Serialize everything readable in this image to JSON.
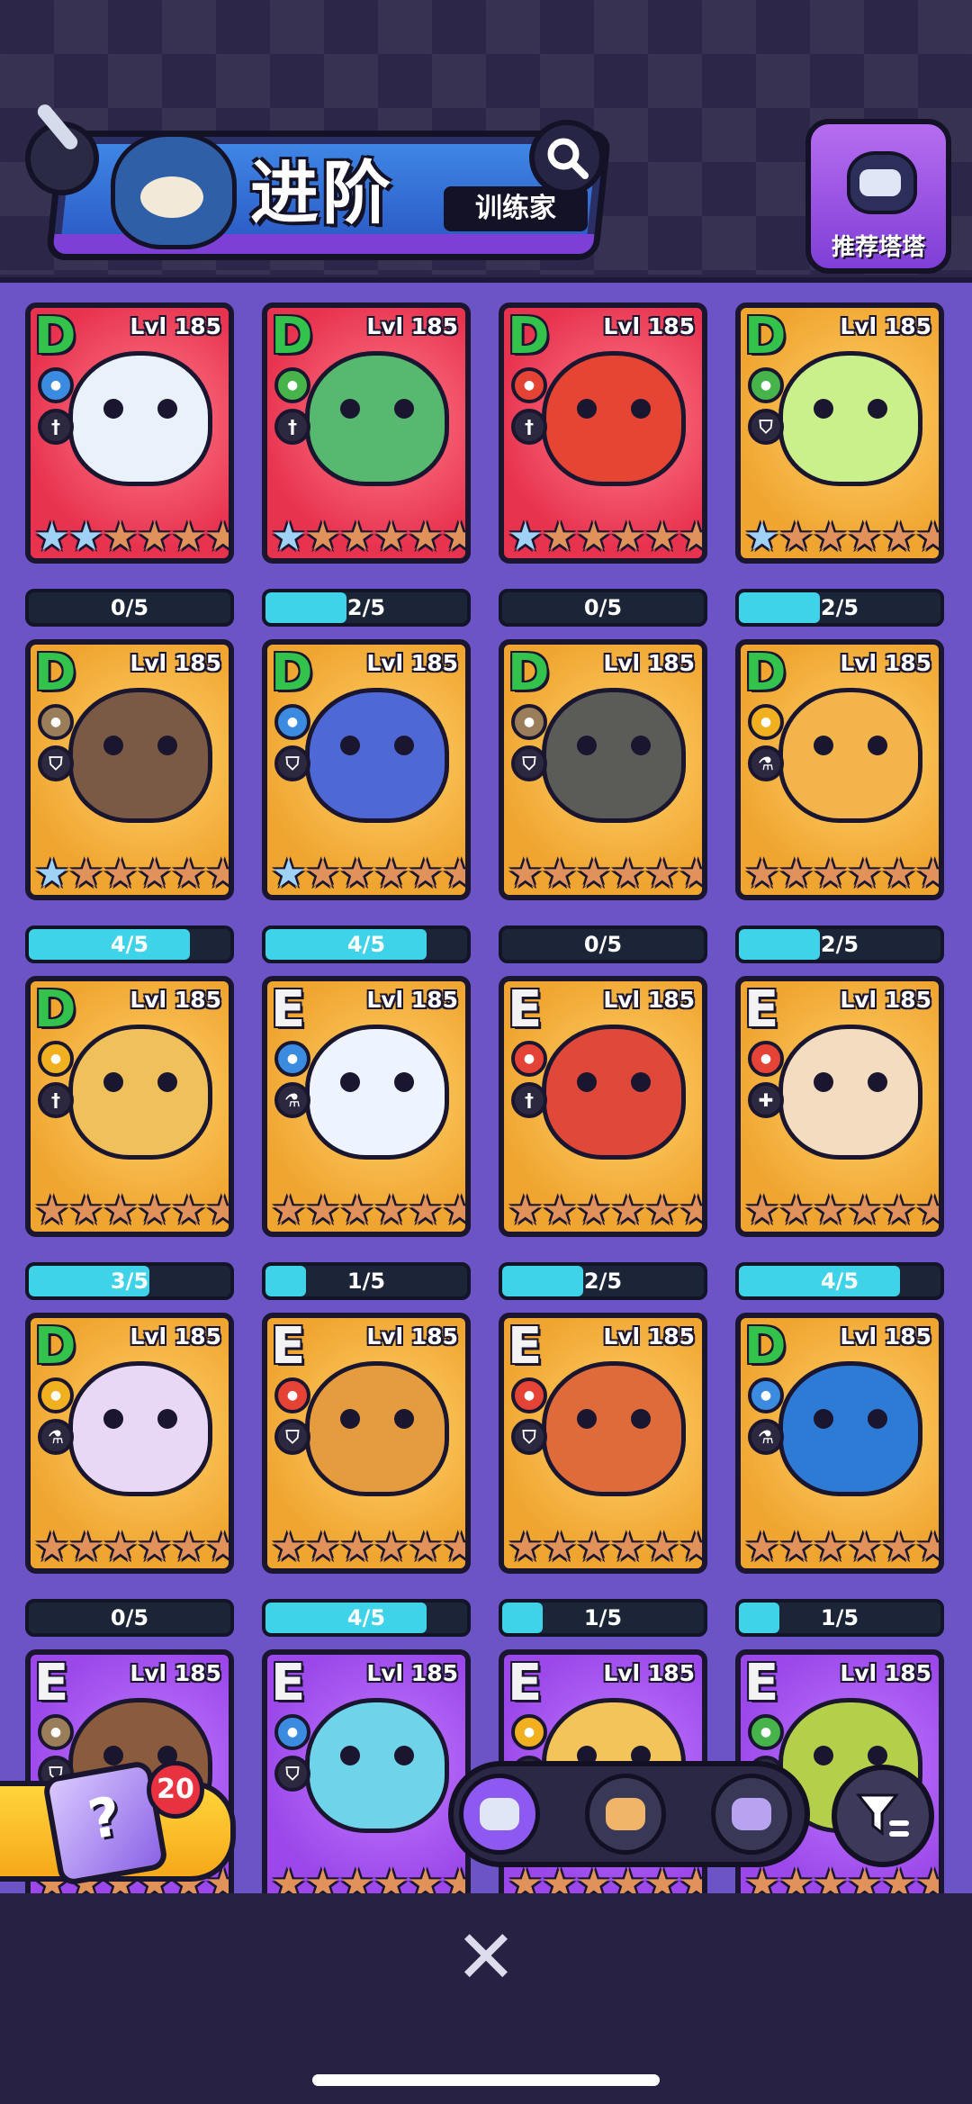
{
  "header": {
    "title": "进阶",
    "subtitle": "训练家",
    "recommend_label": "推荐塔塔"
  },
  "cards": [
    {
      "grade": "D",
      "level": "Lvl 185",
      "bg": "pink",
      "element_color": "#3b8be0",
      "role_icon": "dagger-icon",
      "creature_color": "#e9f1fb",
      "silver_stars": 2,
      "progress": "0/5",
      "progress_fraction": 0.0
    },
    {
      "grade": "D",
      "level": "Lvl 185",
      "bg": "pink",
      "element_color": "#47b34b",
      "role_icon": "dagger-icon",
      "creature_color": "#57b870",
      "silver_stars": 1,
      "progress": "2/5",
      "progress_fraction": 0.4
    },
    {
      "grade": "D",
      "level": "Lvl 185",
      "bg": "pink",
      "element_color": "#e44336",
      "role_icon": "dagger-icon",
      "creature_color": "#e54532",
      "silver_stars": 1,
      "progress": "0/5",
      "progress_fraction": 0.0
    },
    {
      "grade": "D",
      "level": "Lvl 185",
      "bg": "gold",
      "element_color": "#47b34b",
      "role_icon": "shield-icon",
      "creature_color": "#c9f08a",
      "silver_stars": 1,
      "progress": "2/5",
      "progress_fraction": 0.4
    },
    {
      "grade": "D",
      "level": "Lvl 185",
      "bg": "gold",
      "element_color": "#9a7d59",
      "role_icon": "shield-icon",
      "creature_color": "#7a5a45",
      "silver_stars": 1,
      "progress": "4/5",
      "progress_fraction": 0.8
    },
    {
      "grade": "D",
      "level": "Lvl 185",
      "bg": "gold",
      "element_color": "#3b8be0",
      "role_icon": "shield-icon",
      "creature_color": "#4e68d6",
      "silver_stars": 1,
      "progress": "4/5",
      "progress_fraction": 0.8
    },
    {
      "grade": "D",
      "level": "Lvl 185",
      "bg": "gold",
      "element_color": "#9a7d59",
      "role_icon": "shield-icon",
      "creature_color": "#5b5b57",
      "silver_stars": 0,
      "progress": "0/5",
      "progress_fraction": 0.0
    },
    {
      "grade": "D",
      "level": "Lvl 185",
      "bg": "gold",
      "element_color": "#f0b020",
      "role_icon": "flask-icon",
      "creature_color": "#f3b44c",
      "silver_stars": 0,
      "progress": "2/5",
      "progress_fraction": 0.4
    },
    {
      "grade": "D",
      "level": "Lvl 185",
      "bg": "gold",
      "element_color": "#f0b020",
      "role_icon": "dagger-icon",
      "creature_color": "#f0c05a",
      "silver_stars": 0,
      "progress": "3/5",
      "progress_fraction": 0.6
    },
    {
      "grade": "E",
      "level": "Lvl 185",
      "bg": "gold",
      "element_color": "#3b8be0",
      "role_icon": "flask-icon",
      "creature_color": "#eef4ff",
      "silver_stars": 0,
      "progress": "1/5",
      "progress_fraction": 0.2
    },
    {
      "grade": "E",
      "level": "Lvl 185",
      "bg": "gold",
      "element_color": "#e44336",
      "role_icon": "dagger-icon",
      "creature_color": "#e0483a",
      "silver_stars": 0,
      "progress": "2/5",
      "progress_fraction": 0.4
    },
    {
      "grade": "E",
      "level": "Lvl 185",
      "bg": "gold",
      "element_color": "#e44336",
      "role_icon": "heal-icon",
      "creature_color": "#f4dcc0",
      "silver_stars": 0,
      "progress": "4/5",
      "progress_fraction": 0.8
    },
    {
      "grade": "D",
      "level": "Lvl 185",
      "bg": "gold",
      "element_color": "#f0b020",
      "role_icon": "flask-icon",
      "creature_color": "#e8d8f6",
      "silver_stars": 0,
      "progress": "0/5",
      "progress_fraction": 0.0
    },
    {
      "grade": "E",
      "level": "Lvl 185",
      "bg": "gold",
      "element_color": "#e44336",
      "role_icon": "shield-icon",
      "creature_color": "#e59c3f",
      "silver_stars": 0,
      "progress": "4/5",
      "progress_fraction": 0.8
    },
    {
      "grade": "E",
      "level": "Lvl 185",
      "bg": "gold",
      "element_color": "#e44336",
      "role_icon": "shield-icon",
      "creature_color": "#df6a3a",
      "silver_stars": 0,
      "progress": "1/5",
      "progress_fraction": 0.2
    },
    {
      "grade": "D",
      "level": "Lvl 185",
      "bg": "gold",
      "element_color": "#3b8be0",
      "role_icon": "flask-icon",
      "creature_color": "#2e7bd6",
      "silver_stars": 0,
      "progress": "1/5",
      "progress_fraction": 0.2
    },
    {
      "grade": "E",
      "level": "Lvl 185",
      "bg": "purple",
      "element_color": "#9a7d59",
      "role_icon": "shield-icon",
      "creature_color": "#8a5b3d",
      "silver_stars": 0,
      "progress": "",
      "progress_fraction": 0.0
    },
    {
      "grade": "E",
      "level": "Lvl 185",
      "bg": "purple",
      "element_color": "#3b8be0",
      "role_icon": "shield-icon",
      "creature_color": "#6fd4ea",
      "silver_stars": 0,
      "progress": "",
      "progress_fraction": 0.0
    },
    {
      "grade": "E",
      "level": "Lvl 185",
      "bg": "purple",
      "element_color": "#f0b020",
      "role_icon": "shield-icon",
      "creature_color": "#f2c45a",
      "silver_stars": 0,
      "progress": "",
      "progress_fraction": 0.0
    },
    {
      "grade": "E",
      "level": "Lvl 185",
      "bg": "purple",
      "element_color": "#47b34b",
      "role_icon": "shield-icon",
      "creature_color": "#b4d04a",
      "silver_stars": 0,
      "progress": "",
      "progress_fraction": 0.0
    }
  ],
  "mystery_box": {
    "count": "20",
    "icon": "mystery-cube-icon",
    "symbol": "?"
  },
  "filter_tabs": [
    {
      "name": "filter-tab-tower",
      "icon": "robot-cat-icon",
      "active": true,
      "face_color": "#dfe6f6"
    },
    {
      "name": "filter-tab-pet",
      "icon": "bread-face-icon",
      "active": false,
      "face_color": "#f1b56a"
    },
    {
      "name": "filter-tab-gem",
      "icon": "crystal-cat-icon",
      "active": false,
      "face_color": "#b8a3f0"
    }
  ],
  "close_label": "✕"
}
